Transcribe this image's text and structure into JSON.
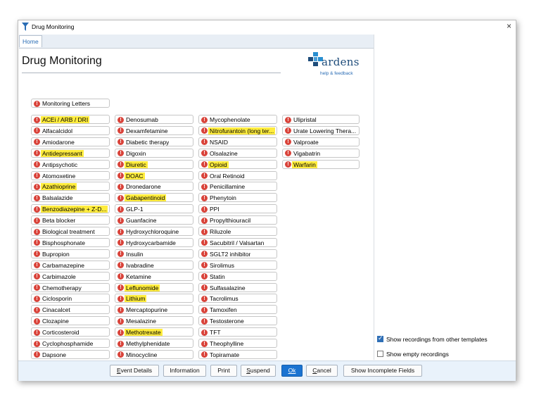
{
  "window": {
    "title": "Drug Monitoring",
    "close_label": "×"
  },
  "tabs": {
    "home": "Home"
  },
  "page": {
    "title": "Drug Monitoring"
  },
  "logo": {
    "word": "ardens",
    "help": "help & feedback"
  },
  "monitoring_letters": "Monitoring Letters",
  "alert_glyph": "!",
  "columns": [
    [
      {
        "label": "ACEi / ARB / DRI",
        "hl": true
      },
      {
        "label": "Alfacalcidol",
        "hl": false
      },
      {
        "label": "Amiodarone",
        "hl": false
      },
      {
        "label": "Antidepressant",
        "hl": true
      },
      {
        "label": "Antipsychotic",
        "hl": false
      },
      {
        "label": "Atomoxetine",
        "hl": false
      },
      {
        "label": "Azathioprine",
        "hl": true
      },
      {
        "label": "Balsalazide",
        "hl": false
      },
      {
        "label": "Benzodiazepine + Z-D...",
        "hl": true
      },
      {
        "label": "Beta blocker",
        "hl": false
      },
      {
        "label": "Biological treatment",
        "hl": false
      },
      {
        "label": "Bisphosphonate",
        "hl": false
      },
      {
        "label": "Bupropion",
        "hl": false
      },
      {
        "label": "Carbamazepine",
        "hl": false
      },
      {
        "label": "Carbimazole",
        "hl": false
      },
      {
        "label": "Chemotherapy",
        "hl": false
      },
      {
        "label": "Ciclosporin",
        "hl": false
      },
      {
        "label": "Cinacalcet",
        "hl": false
      },
      {
        "label": "Clozapine",
        "hl": false
      },
      {
        "label": "Corticosteroid",
        "hl": false
      },
      {
        "label": "Cyclophosphamide",
        "hl": false
      },
      {
        "label": "Dapsone",
        "hl": false
      }
    ],
    [
      {
        "label": "Denosumab",
        "hl": false
      },
      {
        "label": "Dexamfetamine",
        "hl": false
      },
      {
        "label": "Diabetic therapy",
        "hl": false
      },
      {
        "label": "Digoxin",
        "hl": false
      },
      {
        "label": "Diuretic",
        "hl": true
      },
      {
        "label": "DOAC",
        "hl": true
      },
      {
        "label": "Dronedarone",
        "hl": false
      },
      {
        "label": "Gabapentinoid",
        "hl": true
      },
      {
        "label": "GLP-1",
        "hl": false
      },
      {
        "label": "Guanfacine",
        "hl": false
      },
      {
        "label": "Hydroxychloroquine",
        "hl": false
      },
      {
        "label": "Hydroxycarbamide",
        "hl": false
      },
      {
        "label": "Insulin",
        "hl": false
      },
      {
        "label": "Ivabradine",
        "hl": false
      },
      {
        "label": "Ketamine",
        "hl": false
      },
      {
        "label": "Leflunomide",
        "hl": true
      },
      {
        "label": "Lithium",
        "hl": true
      },
      {
        "label": "Mercaptopurine",
        "hl": false
      },
      {
        "label": "Mesalazine",
        "hl": false
      },
      {
        "label": "Methotrexate",
        "hl": true
      },
      {
        "label": "Methylphenidate",
        "hl": false
      },
      {
        "label": "Minocycline",
        "hl": false
      }
    ],
    [
      {
        "label": "Mycophenolate",
        "hl": false
      },
      {
        "label": "Nitrofurantoin (long ter...",
        "hl": true
      },
      {
        "label": "NSAID",
        "hl": false
      },
      {
        "label": "Olsalazine",
        "hl": false
      },
      {
        "label": "Opioid",
        "hl": true
      },
      {
        "label": "Oral Retinoid",
        "hl": false
      },
      {
        "label": "Penicillamine",
        "hl": false
      },
      {
        "label": "Phenytoin",
        "hl": false
      },
      {
        "label": "PPI",
        "hl": false
      },
      {
        "label": "Propylthiouracil",
        "hl": false
      },
      {
        "label": "Riluzole",
        "hl": false
      },
      {
        "label": "Sacubitril / Valsartan",
        "hl": false
      },
      {
        "label": "SGLT2 inhibitor",
        "hl": false
      },
      {
        "label": "Sirolimus",
        "hl": false
      },
      {
        "label": "Statin",
        "hl": false
      },
      {
        "label": "Sulfasalazine",
        "hl": false
      },
      {
        "label": "Tacrolimus",
        "hl": false
      },
      {
        "label": "Tamoxifen",
        "hl": false
      },
      {
        "label": "Testosterone",
        "hl": false
      },
      {
        "label": "TFT",
        "hl": false
      },
      {
        "label": "Theophylline",
        "hl": false
      },
      {
        "label": "Topiramate",
        "hl": false
      }
    ],
    [
      {
        "label": "Ulipristal",
        "hl": false
      },
      {
        "label": "Urate Lowering Thera...",
        "hl": false
      },
      {
        "label": "Valproate",
        "hl": false
      },
      {
        "label": "Vigabatrin",
        "hl": false
      },
      {
        "label": "Warfarin",
        "hl": true
      }
    ]
  ],
  "options": {
    "show_other_templates": {
      "label": "Show recordings from other templates",
      "checked": true
    },
    "show_empty": {
      "label": "Show empty recordings",
      "checked": false
    }
  },
  "buttons": {
    "event_details": "Event Details",
    "information": "Information",
    "print": "Print",
    "suspend": "Suspend",
    "ok": "Ok",
    "cancel": "Cancel",
    "show_incomplete": "Show Incomplete Fields"
  },
  "colors": {
    "alert": "#d9433a",
    "highlight": "#ffec3d",
    "accent": "#1a73d1",
    "logo_blue": "#1e4c7a",
    "logo_teal": "#2a8fd0"
  }
}
